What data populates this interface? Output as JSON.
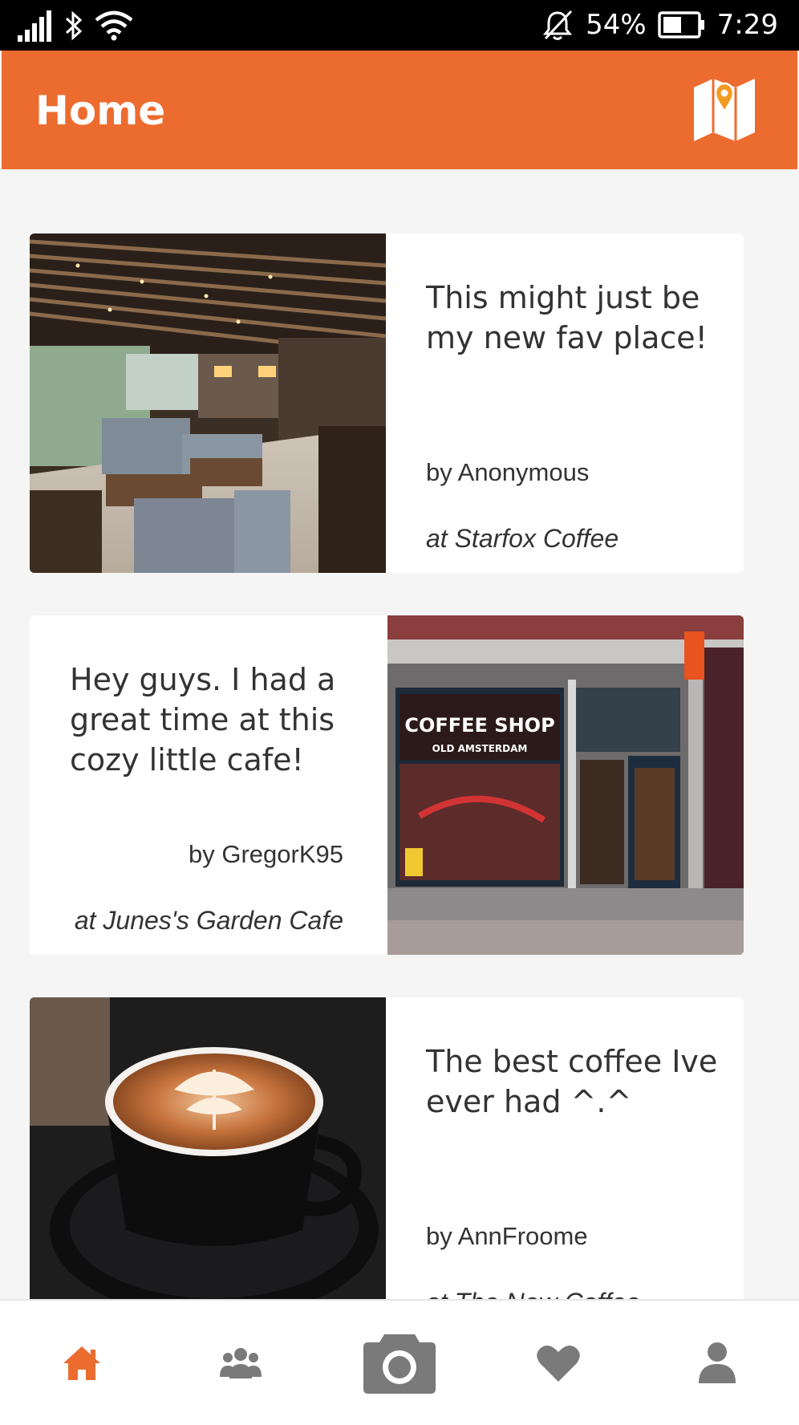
{
  "status_bar": {
    "battery_percent": "54%",
    "time": "7:29",
    "icons": [
      "signal-icon",
      "bluetooth-icon",
      "wifi-icon",
      "alarm-off-icon",
      "battery-icon"
    ]
  },
  "app_bar": {
    "title": "Home",
    "map_button_icon": "map-icon"
  },
  "posts": [
    {
      "headline": "This might just be my new fav place!",
      "author": "by Anonymous",
      "place": "at Starfox Coffee",
      "image": "cafe-interior-photo"
    },
    {
      "headline": "Hey guys. I had a great time at this cozy little cafe!",
      "author": "by GregorK95",
      "place": "at Junes's Garden Cafe",
      "image": "coffee-shop-storefront-photo",
      "storefront_sign": "COFFEE SHOP",
      "storefront_subsign": "OLD AMSTERDAM"
    },
    {
      "headline": "The best coffee Ive ever had ^.^",
      "author": "by AnnFroome",
      "place": "at The New Coffee",
      "image": "latte-art-photo"
    }
  ],
  "bottom_nav": {
    "items": [
      "home-icon",
      "people-icon",
      "camera-icon",
      "heart-icon",
      "profile-icon"
    ],
    "active": "home-icon"
  },
  "colors": {
    "accent": "#ec6c2f",
    "inactive_icon": "#7a7a7a",
    "background": "#f5f5f5"
  }
}
